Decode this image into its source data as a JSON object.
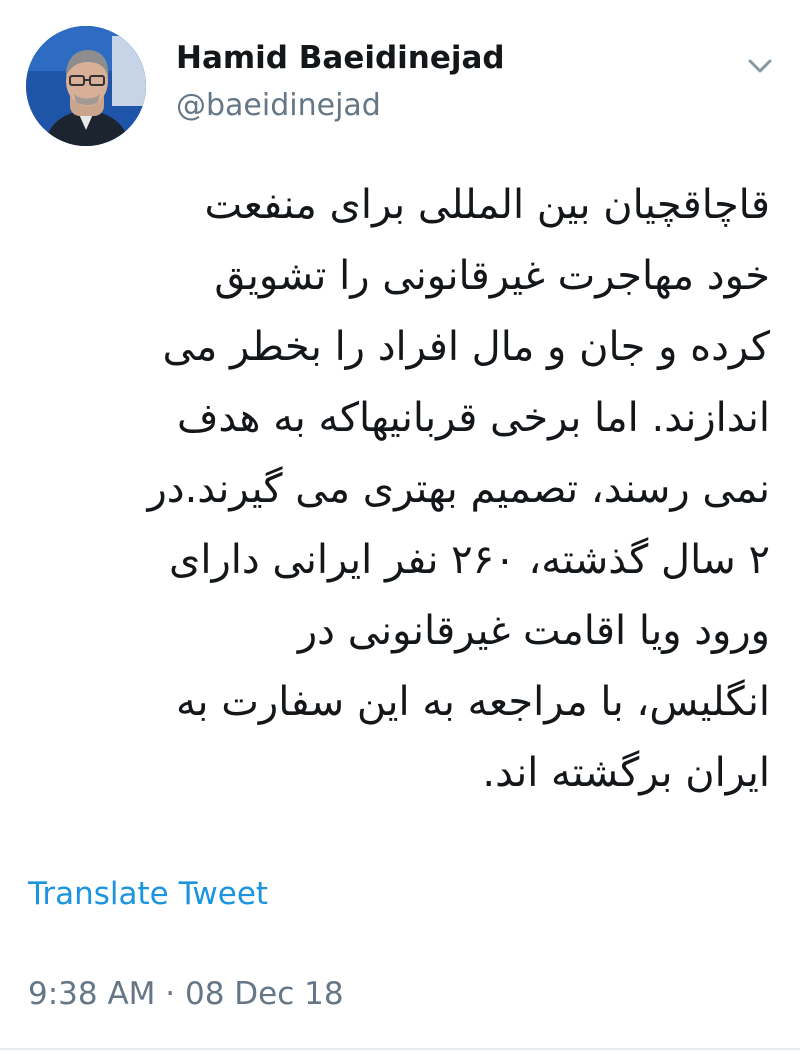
{
  "user": {
    "display_name": "Hamid Baeidinejad",
    "handle": "@baeidinejad",
    "avatar_icon": "profile-photo",
    "menu_icon": "chevron-down-icon"
  },
  "tweet": {
    "lines": [
      "قاچاقچیان بین المللی برای منفعت",
      "خود مهاجرت غیرقانونی را تشویق",
      "کرده و جان و مال افراد را بخطر می",
      "اندازند. اما برخی قربانیهاکه به هدف",
      "نمی رسند، تصمیم بهتری می گیرند.در",
      "۲ سال گذشته، ۲۶۰ نفر ایرانی دارای",
      "ورود ویا اقامت غیرقانونی در",
      "انگلیس، با مراجعه به این سفارت به",
      "ایران برگشته اند."
    ]
  },
  "translate_label": "Translate Tweet",
  "timestamp": "9:38 AM · 08 Dec 18",
  "colors": {
    "link": "#1b95e0",
    "secondary_text": "#657786",
    "primary_text": "#14171a"
  }
}
